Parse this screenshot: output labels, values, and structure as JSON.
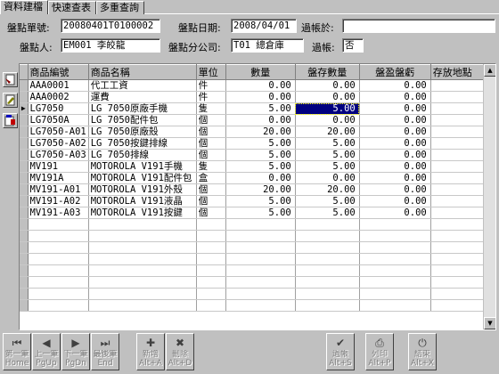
{
  "tabs": [
    "資料建檔",
    "快速查表",
    "多重查詢"
  ],
  "header": {
    "doc_no_label": "盤點單號:",
    "doc_no": "20080401T0100002",
    "date_label": "盤點日期:",
    "date": "2008/04/01",
    "posted_at_label": "過帳於:",
    "posted_at": "",
    "counter_label": "盤點人:",
    "counter": "EM001      李皎龍",
    "branch_label": "盤點分公司:",
    "branch": "T01 總倉庫",
    "posted_label": "過帳:",
    "posted": "否"
  },
  "grid": {
    "columns": [
      "商品編號",
      "商品名稱",
      "單位",
      "數量",
      "盤存數量",
      "盤盈盤虧",
      "存放地點"
    ],
    "rows": [
      [
        "AAA0001",
        "代工工資",
        "件",
        "0.00",
        "0.00",
        "0.00",
        ""
      ],
      [
        "AAA0002",
        "運費",
        "件",
        "0.00",
        "0.00",
        "0.00",
        ""
      ],
      [
        "LG7050",
        "LG 7050原廠手機",
        "隻",
        "5.00",
        "5.00",
        "0.00",
        ""
      ],
      [
        "LG7050A",
        "LG 7050配件包",
        "個",
        "0.00",
        "0.00",
        "0.00",
        ""
      ],
      [
        "LG7050-A01",
        "LG 7050原廠殼",
        "個",
        "20.00",
        "20.00",
        "0.00",
        ""
      ],
      [
        "LG7050-A02",
        "LG 7050按鍵排線",
        "個",
        "5.00",
        "5.00",
        "0.00",
        ""
      ],
      [
        "LG7050-A03",
        "LG 7050排線",
        "個",
        "5.00",
        "5.00",
        "0.00",
        ""
      ],
      [
        "MV191",
        "MOTOROLA V191手機",
        "隻",
        "5.00",
        "5.00",
        "0.00",
        ""
      ],
      [
        "MV191A",
        "MOTOROLA V191配件包",
        "盒",
        "0.00",
        "0.00",
        "0.00",
        ""
      ],
      [
        "MV191-A01",
        "MOTOROLA V191外殼",
        "個",
        "20.00",
        "20.00",
        "0.00",
        ""
      ],
      [
        "MV191-A02",
        "MOTOROLA V191液晶",
        "個",
        "5.00",
        "5.00",
        "0.00",
        ""
      ],
      [
        "MV191-A03",
        "MOTOROLA V191按鍵",
        "個",
        "5.00",
        "5.00",
        "0.00",
        ""
      ]
    ]
  },
  "toolbar": [
    {
      "line1": "第一筆",
      "line2": "Home",
      "icon": "first-record-icon"
    },
    {
      "line1": "上一筆",
      "line2": "PgUp",
      "icon": "prev-record-icon"
    },
    {
      "line1": "下一筆",
      "line2": "PgDn",
      "icon": "next-record-icon"
    },
    {
      "line1": "最後筆",
      "line2": "End",
      "icon": "last-record-icon"
    },
    {
      "line1": "新增",
      "line2": "Alt+A",
      "icon": "add-icon"
    },
    {
      "line1": "刪除",
      "line2": "Alt+D",
      "icon": "delete-icon"
    },
    {
      "line1": "過帳",
      "line2": "Alt+S",
      "icon": "post-icon"
    },
    {
      "line1": "列印",
      "line2": "Alt+P",
      "icon": "print-icon"
    },
    {
      "line1": "結束",
      "line2": "Alt+X",
      "icon": "exit-icon"
    }
  ]
}
